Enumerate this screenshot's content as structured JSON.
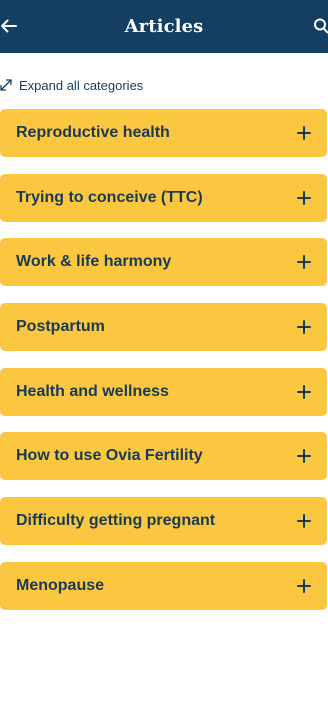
{
  "header": {
    "title": "Articles",
    "back_icon": "arrow-left-icon",
    "search_icon": "search-icon"
  },
  "expand": {
    "label": "Expand all categories",
    "icon": "expand-arrows-icon"
  },
  "categories": [
    {
      "label": "Reproductive health"
    },
    {
      "label": "Trying to conceive (TTC)"
    },
    {
      "label": "Work & life harmony"
    },
    {
      "label": "Postpartum"
    },
    {
      "label": "Health and wellness"
    },
    {
      "label": "How to use Ovia Fertility"
    },
    {
      "label": "Difficulty getting pregnant"
    },
    {
      "label": "Menopause"
    }
  ],
  "colors": {
    "header_bg": "#143f63",
    "card_bg": "#fbc740",
    "card_text": "#193a56",
    "link_text": "#163e5c"
  }
}
